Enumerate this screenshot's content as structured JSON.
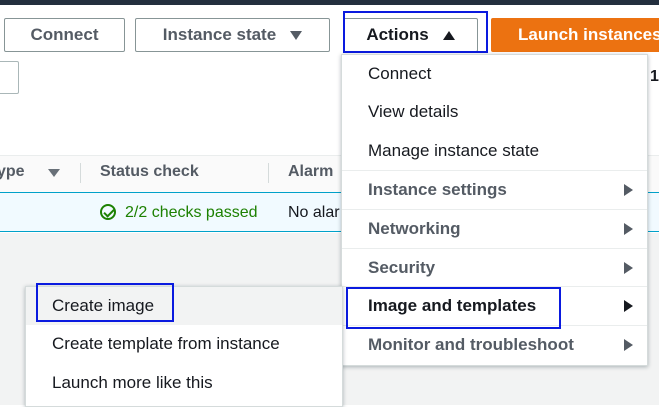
{
  "toolbar": {
    "connect_label": "Connect",
    "instance_state_label": "Instance state",
    "actions_label": "Actions",
    "launch_label": "Launch instances"
  },
  "pagination": {
    "page": "1"
  },
  "table": {
    "headers": [
      "ype",
      "Status check",
      "Alarm"
    ],
    "row": {
      "status_check": "2/2 checks passed",
      "alarm": "No alarms"
    }
  },
  "actions_menu": {
    "items": [
      {
        "label": "Connect"
      },
      {
        "label": "View details"
      },
      {
        "label": "Manage instance state"
      },
      {
        "label": "Instance settings"
      },
      {
        "label": "Networking"
      },
      {
        "label": "Security"
      },
      {
        "label": "Image and templates"
      },
      {
        "label": "Monitor and troubleshoot"
      }
    ]
  },
  "image_submenu": {
    "items": [
      {
        "label": "Create image"
      },
      {
        "label": "Create template from instance"
      },
      {
        "label": "Launch more like this"
      }
    ]
  },
  "colors": {
    "accent_orange": "#ec7211",
    "highlight_blue": "#0a1adf",
    "success_green": "#1d8102"
  }
}
